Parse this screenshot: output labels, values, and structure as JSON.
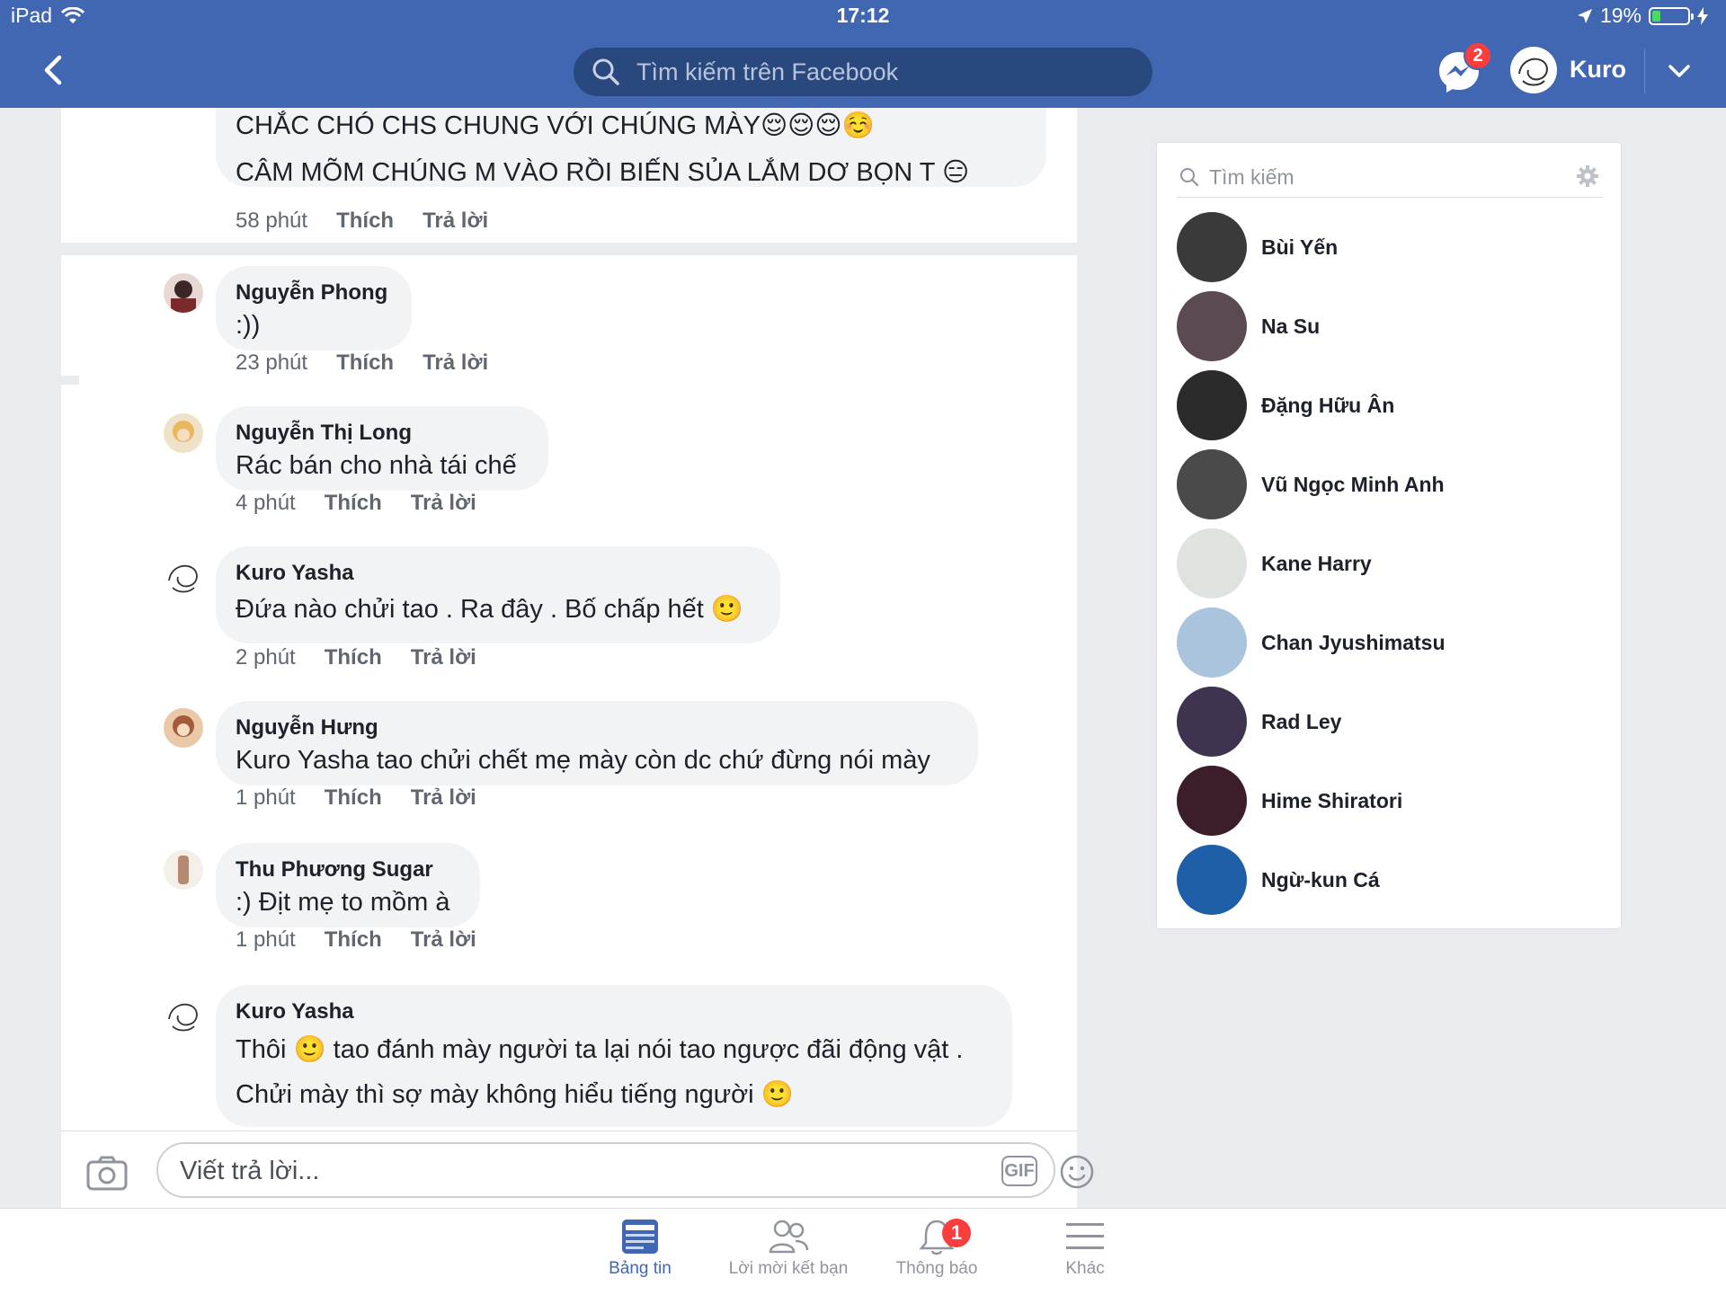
{
  "status_bar": {
    "device": "iPad",
    "time": "17:12",
    "battery": "19%"
  },
  "header": {
    "search_placeholder": "Tìm kiếm trên Facebook",
    "messenger_badge": "2",
    "profile_name": "Kuro"
  },
  "comments": [
    {
      "lines": [
        "CHẮC CHÓ CHS CHUNG VỚI CHÚNG MÀY😌😌😌☺️",
        "CÂM MÕM  CHÚNG M VÀO RỒI BIẾN SỦA LẮM DƠ BỌN T 😑"
      ],
      "time": "58 phút",
      "like": "Thích",
      "reply": "Trả lời"
    },
    {
      "author": "Nguyễn Phong",
      "lines": [
        ":))"
      ],
      "time": "23 phút",
      "like": "Thích",
      "reply": "Trả lời"
    },
    {
      "author": "Nguyễn Thị Long",
      "lines": [
        "Rác bán cho nhà tái chế"
      ],
      "time": "4 phút",
      "like": "Thích",
      "reply": "Trả lời"
    },
    {
      "author": "Kuro Yasha",
      "lines": [
        "Đứa nào chửi tao . Ra đây . Bố chấp hết 🙂"
      ],
      "time": "2 phút",
      "like": "Thích",
      "reply": "Trả lời"
    },
    {
      "author": "Nguyễn Hưng",
      "lines": [
        "Kuro Yasha tao chửi chết mẹ mày còn dc chứ đừng nói mày"
      ],
      "time": "1 phút",
      "like": "Thích",
      "reply": "Trả lời"
    },
    {
      "author": "Thu Phương Sugar",
      "lines": [
        ":) Địt mẹ to mồm à"
      ],
      "time": "1 phút",
      "like": "Thích",
      "reply": "Trả lời"
    },
    {
      "author": "Kuro Yasha",
      "lines": [
        "Thôi 🙂 tao đánh mày người ta lại nói tao ngược đãi động vật .",
        "Chửi mày thì sợ mày không hiểu tiếng người 🙂"
      ]
    }
  ],
  "reply_box": {
    "placeholder": "Viết trả lời...",
    "gif_label": "GIF"
  },
  "contacts": {
    "search_placeholder": "Tìm kiếm",
    "items": [
      {
        "name": "Bùi Yến",
        "color": "#3a3a3a"
      },
      {
        "name": "Na Su",
        "color": "#5b4a52"
      },
      {
        "name": "Đặng Hữu Ân",
        "color": "#2b2b2b"
      },
      {
        "name": "Vũ Ngọc Minh Anh",
        "color": "#4a4a4a"
      },
      {
        "name": "Kane Harry",
        "color": "#dfe3e0"
      },
      {
        "name": "Chan Jyushimatsu",
        "color": "#a9c4dc"
      },
      {
        "name": "Rad Ley",
        "color": "#3e3450"
      },
      {
        "name": "Hime Shiratori",
        "color": "#3b1e2a"
      },
      {
        "name": "Ngừ-kun Cá",
        "color": "#1f5fa8"
      }
    ]
  },
  "tabs": [
    {
      "label": "Bảng tin",
      "active": true
    },
    {
      "label": "Lời mời kết bạn"
    },
    {
      "label": "Thông báo",
      "badge": "1"
    },
    {
      "label": "Khác"
    }
  ],
  "colors": {
    "brand": "#4267b2",
    "search_bg": "#29487d",
    "badge": "#fa3e3e",
    "bubble": "#f2f3f5"
  }
}
